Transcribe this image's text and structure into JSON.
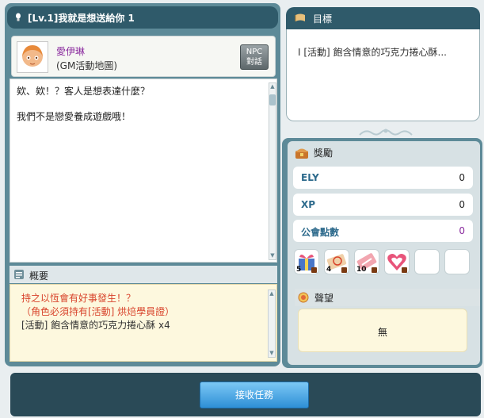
{
  "quest": {
    "title": "[Lv.1]我就是想送給你 1"
  },
  "npc": {
    "name": "愛伊琳",
    "location": "(GM活動地圖)",
    "talk_button": "NPC\n對話"
  },
  "dialog": {
    "lines": [
      "欸、欸！？客人是想表達什麼？",
      "我們不是戀愛養成遊戲哦！"
    ]
  },
  "summary": {
    "label": "概要",
    "lines": [
      "持之以恆會有好事發生！？",
      "（角色必須持有[活動] 烘焙學員證）",
      "[活動] 飽含情意的巧克力捲心酥 x4"
    ]
  },
  "goal": {
    "label": "目標",
    "item": "I [活動] 飽含情意的巧克力捲心酥..."
  },
  "rewards": {
    "label": "獎勵",
    "rows": [
      {
        "label": "ELY",
        "value": "0"
      },
      {
        "label": "XP",
        "value": "0"
      },
      {
        "label": "公會點數",
        "value": "0"
      }
    ],
    "items": [
      {
        "name": "gift-box-icon",
        "count": "5"
      },
      {
        "name": "coupon-icon",
        "count": "4"
      },
      {
        "name": "ticket-icon",
        "count": "10"
      },
      {
        "name": "heart-icon",
        "count": ""
      }
    ]
  },
  "reputation": {
    "label": "聲望",
    "value": "無"
  },
  "accept_button": "接收任務",
  "colors": {
    "title_bg": "#2f5a6a",
    "frame": "#5d8a98",
    "summary_red": "#d8432b",
    "xp_value_purple": "#8a2a9e"
  }
}
